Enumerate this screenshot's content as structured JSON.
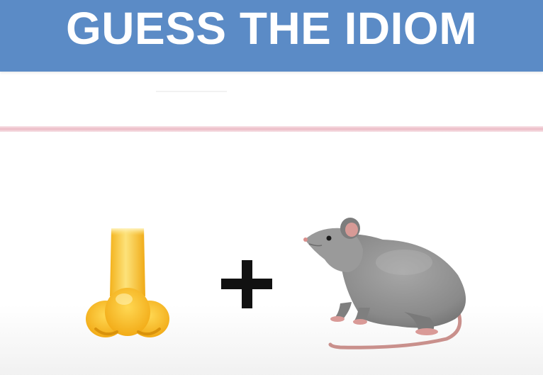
{
  "header": {
    "title": "GUESS THE IDIOM",
    "background_color": "#5b8bc6"
  },
  "puzzle": {
    "items": [
      {
        "icon": "nose-emoji"
      },
      {
        "icon": "plus-sign"
      },
      {
        "icon": "rat-emoji"
      }
    ]
  },
  "colors": {
    "divider": "#eab4bf",
    "nose": "#f7c22e",
    "rat": "#8d8d8d",
    "plus": "#111111"
  }
}
